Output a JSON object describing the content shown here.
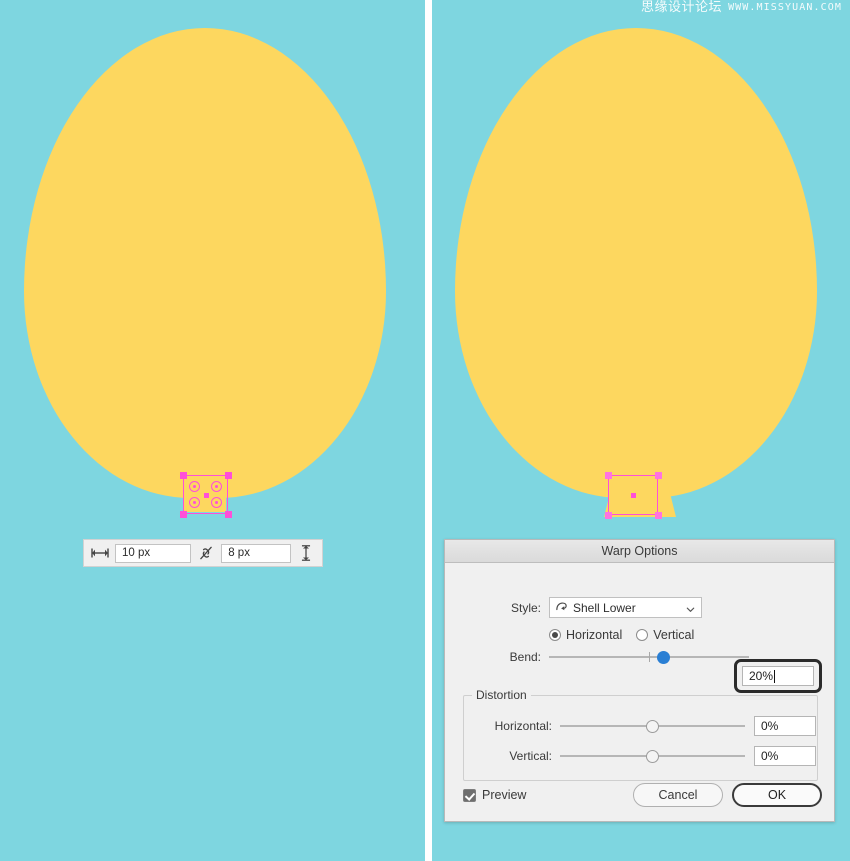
{
  "canvas": {
    "background_color": "#7ed6e0",
    "balloon_color": "#fdd75f",
    "selection_color": "#ff4fd8",
    "left_panel_name": "before-warp-artboard",
    "right_panel_name": "after-warp-artboard"
  },
  "watermark": {
    "chinese": "思缘设计论坛",
    "english": "WWW.MISSYUAN.COM"
  },
  "measure_bar": {
    "width_icon": "width-arrows-icon",
    "width_value": "10 px",
    "link_icon": "broken-link-icon",
    "height_value": "8 px",
    "height_icon": "height-arrows-icon"
  },
  "dialog": {
    "title": "Warp Options",
    "style": {
      "label": "Style:",
      "icon": "warp-shell-lower-icon",
      "value": "Shell Lower",
      "caret_icon": "chevron-down-icon"
    },
    "orientation": {
      "horizontal_label": "Horizontal",
      "horizontal_selected": true,
      "vertical_label": "Vertical",
      "vertical_selected": false
    },
    "bend": {
      "label": "Bend:",
      "value": "20%",
      "slider_percent": 57,
      "tick_percent": 50,
      "focused": true
    },
    "distortion": {
      "legend": "Distortion",
      "horizontal": {
        "label": "Horizontal:",
        "value": "0%",
        "slider_percent": 50
      },
      "vertical": {
        "label": "Vertical:",
        "value": "0%",
        "slider_percent": 50
      }
    },
    "footer": {
      "preview_label": "Preview",
      "preview_checked": true,
      "cancel_label": "Cancel",
      "ok_label": "OK"
    },
    "accent_color": "#2a7fd4"
  }
}
